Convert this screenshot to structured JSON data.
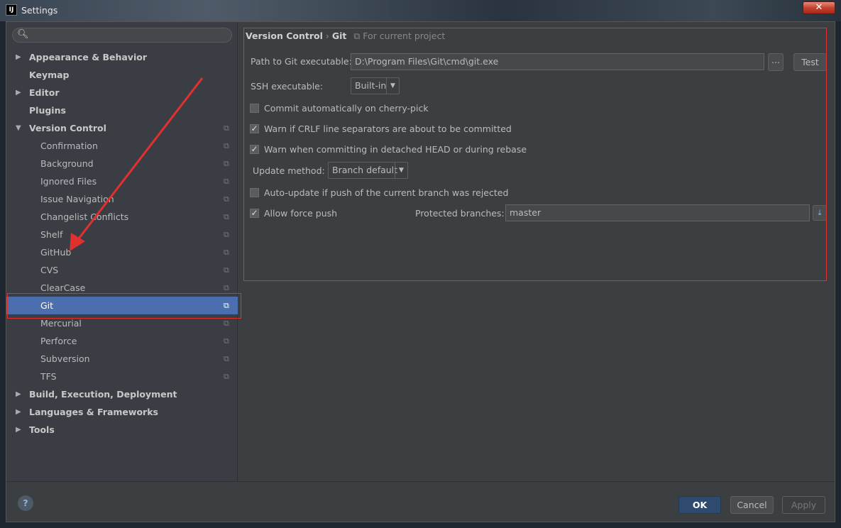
{
  "window": {
    "title": "Settings",
    "logo": "IJ",
    "close_icon": "close-icon"
  },
  "sidebar": {
    "search_placeholder": "",
    "items": [
      {
        "label": "Appearance & Behavior",
        "level": 0,
        "expandable": true,
        "expanded": false
      },
      {
        "label": "Keymap",
        "level": 0,
        "expandable": false
      },
      {
        "label": "Editor",
        "level": 0,
        "expandable": true,
        "expanded": false
      },
      {
        "label": "Plugins",
        "level": 0,
        "expandable": false
      },
      {
        "label": "Version Control",
        "level": 0,
        "expandable": true,
        "expanded": true,
        "project_icon": true
      },
      {
        "label": "Confirmation",
        "level": 1,
        "project_icon": true
      },
      {
        "label": "Background",
        "level": 1,
        "project_icon": true
      },
      {
        "label": "Ignored Files",
        "level": 1,
        "project_icon": true
      },
      {
        "label": "Issue Navigation",
        "level": 1,
        "project_icon": true
      },
      {
        "label": "Changelist Conflicts",
        "level": 1,
        "project_icon": true
      },
      {
        "label": "Shelf",
        "level": 1,
        "project_icon": true
      },
      {
        "label": "GitHub",
        "level": 1,
        "project_icon": true
      },
      {
        "label": "CVS",
        "level": 1,
        "project_icon": true
      },
      {
        "label": "ClearCase",
        "level": 1,
        "project_icon": true
      },
      {
        "label": "Git",
        "level": 1,
        "project_icon": true,
        "selected": true
      },
      {
        "label": "Mercurial",
        "level": 1,
        "project_icon": true
      },
      {
        "label": "Perforce",
        "level": 1,
        "project_icon": true
      },
      {
        "label": "Subversion",
        "level": 1,
        "project_icon": true
      },
      {
        "label": "TFS",
        "level": 1,
        "project_icon": true
      },
      {
        "label": "Build, Execution, Deployment",
        "level": 0,
        "expandable": true,
        "expanded": false
      },
      {
        "label": "Languages & Frameworks",
        "level": 0,
        "expandable": true,
        "expanded": false
      },
      {
        "label": "Tools",
        "level": 0,
        "expandable": true,
        "expanded": false
      }
    ]
  },
  "breadcrumb": {
    "parent": "Version Control",
    "sep": "›",
    "current": "Git",
    "scope": "For current project"
  },
  "git": {
    "path_label": "Path to Git executable:",
    "path_value": "D:\\Program Files\\Git\\cmd\\git.exe",
    "browse_label": "...",
    "test_label": "Test",
    "ssh_label": "SSH executable:",
    "ssh_value": "Built-in",
    "options": [
      {
        "label": "Commit automatically on cherry-pick",
        "checked": false
      },
      {
        "label": "Warn if CRLF line separators are about to be committed",
        "checked": true
      },
      {
        "label": "Warn when committing in detached HEAD or during rebase",
        "checked": true
      }
    ],
    "update_label": "Update method:",
    "update_value": "Branch default",
    "autoupdate": {
      "label": "Auto-update if push of the current branch was rejected",
      "checked": false
    },
    "force_push": {
      "label": "Allow force push",
      "checked": true
    },
    "protected_label": "Protected branches:",
    "protected_value": "master"
  },
  "footer": {
    "help": "?",
    "ok": "OK",
    "cancel": "Cancel",
    "apply": "Apply"
  },
  "colors": {
    "selection": "#4b6eaf",
    "annotation": "#e03030",
    "ok_button": "#2e4a6e"
  }
}
